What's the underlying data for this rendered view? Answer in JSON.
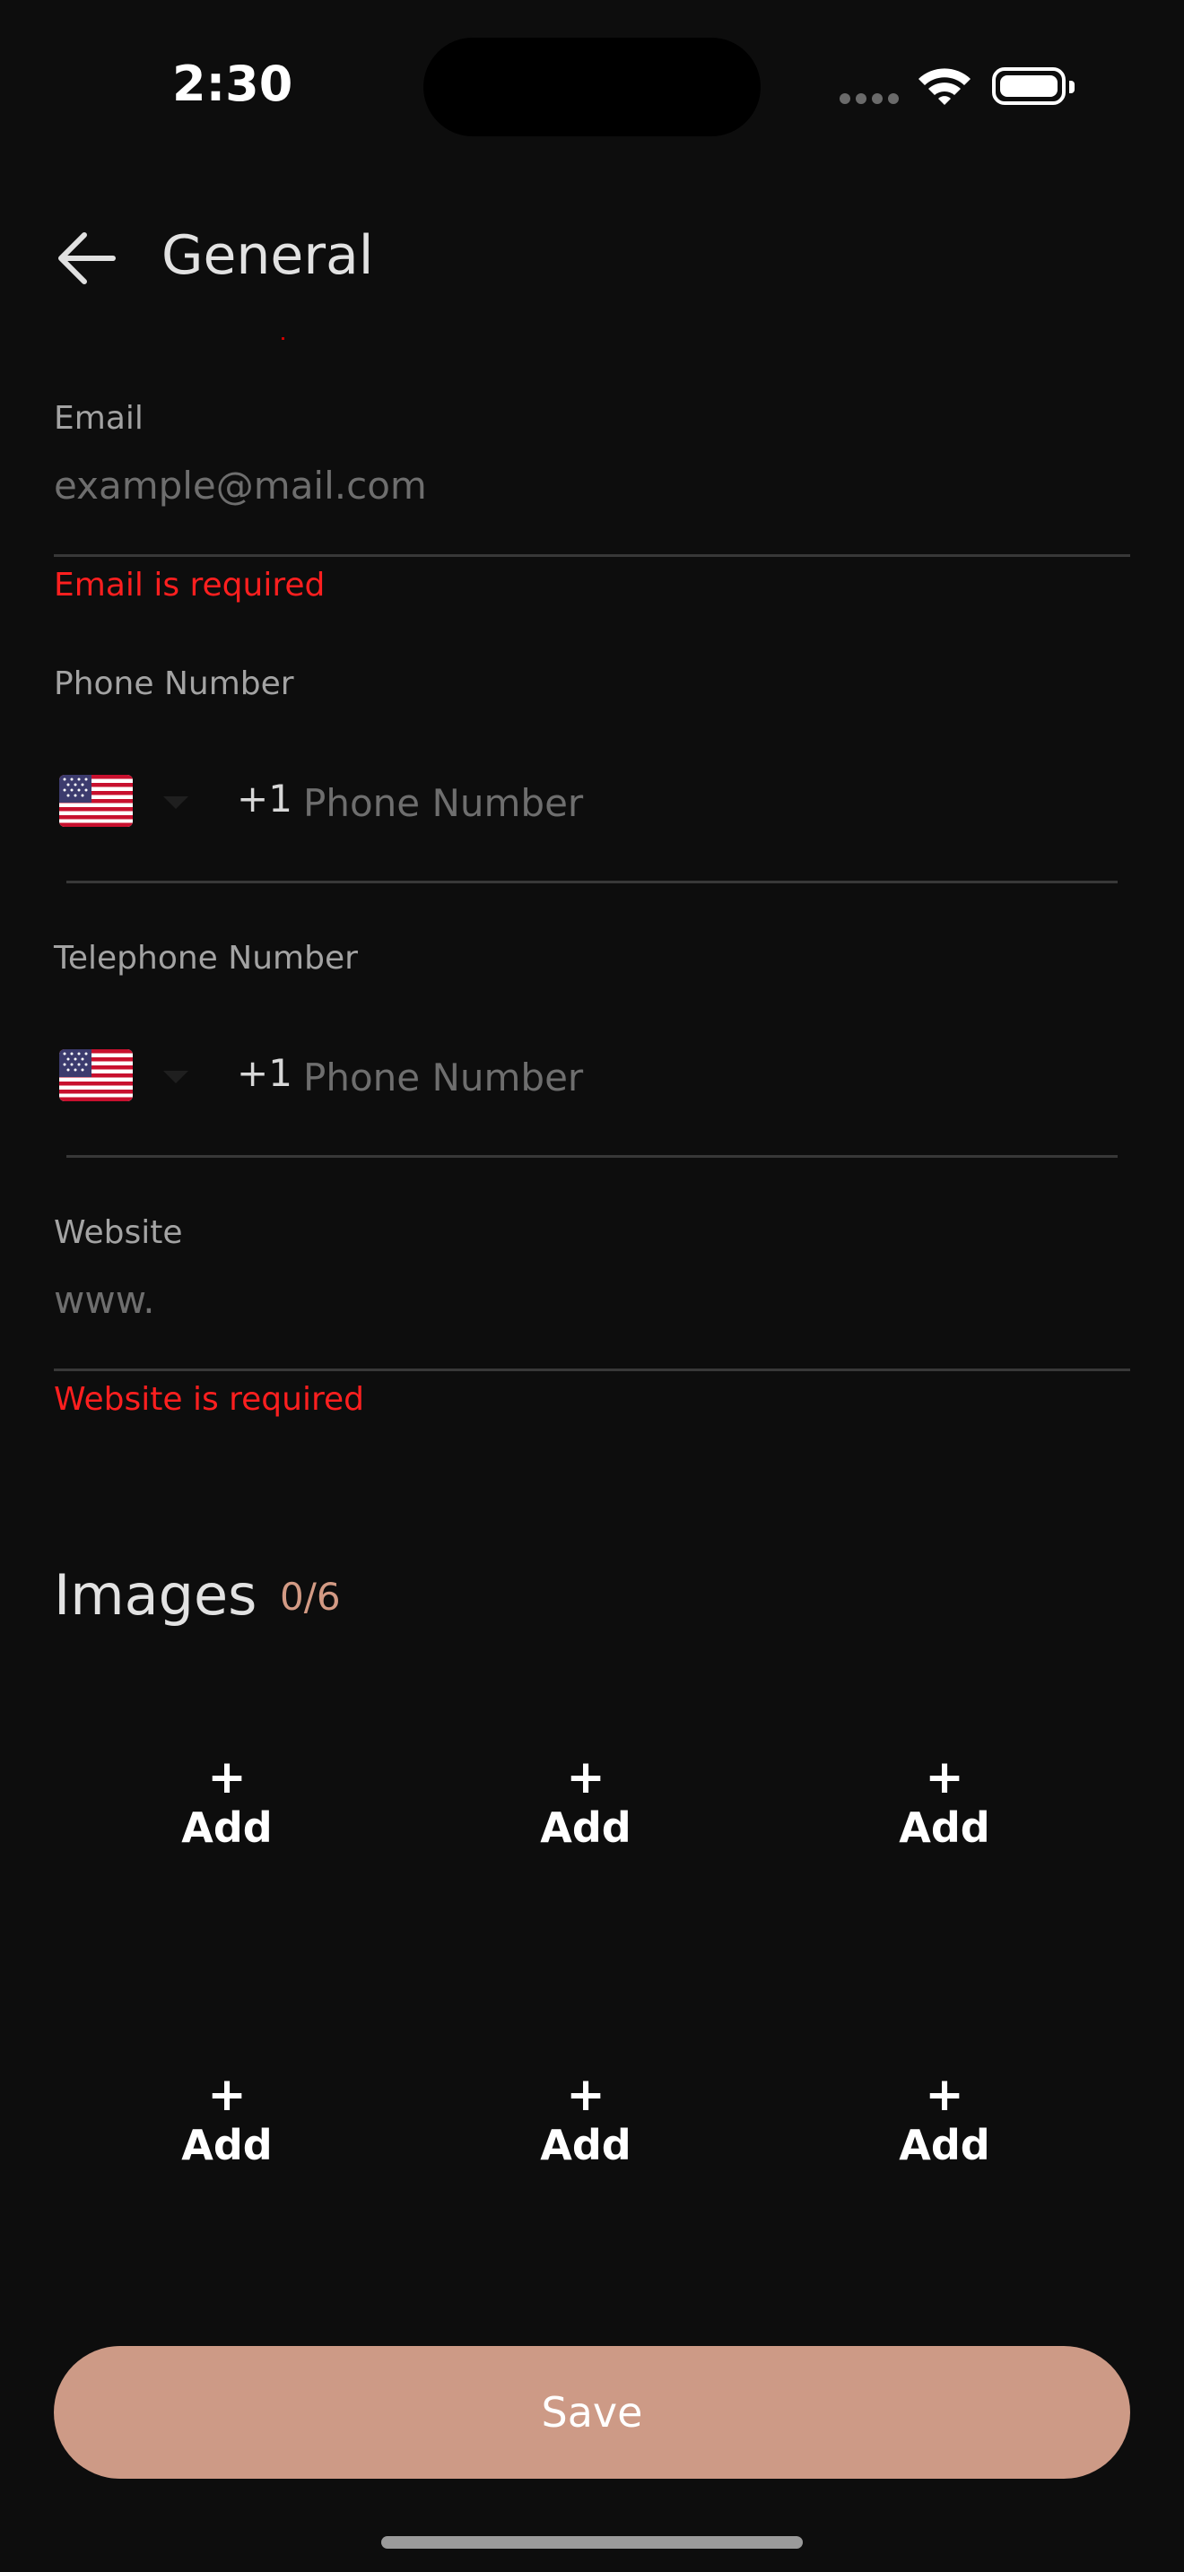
{
  "status_bar": {
    "time": "2:30"
  },
  "header": {
    "title": "General"
  },
  "form": {
    "email": {
      "label": "Email",
      "placeholder": "example@mail.com",
      "value": "",
      "error": "Email is required"
    },
    "phone": {
      "label": "Phone Number",
      "country_flag": "us-flag-icon",
      "dial_code": "+1",
      "placeholder": "Phone Number",
      "value": ""
    },
    "telephone": {
      "label": "Telephone Number",
      "country_flag": "us-flag-icon",
      "dial_code": "+1",
      "placeholder": "Phone Number",
      "value": ""
    },
    "website": {
      "label": "Website",
      "placeholder": "www.",
      "value": "",
      "error": "Website is required"
    }
  },
  "images": {
    "title": "Images",
    "count": "0/6",
    "slots": [
      {
        "plus": "+",
        "label": "Add"
      },
      {
        "plus": "+",
        "label": "Add"
      },
      {
        "plus": "+",
        "label": "Add"
      },
      {
        "plus": "+",
        "label": "Add"
      },
      {
        "plus": "+",
        "label": "Add"
      },
      {
        "plus": "+",
        "label": "Add"
      }
    ]
  },
  "actions": {
    "save_label": "Save"
  },
  "colors": {
    "background": "#0d0d0d",
    "accent": "#cd9a86",
    "error": "#ff1f1f",
    "count": "#d39a84"
  }
}
